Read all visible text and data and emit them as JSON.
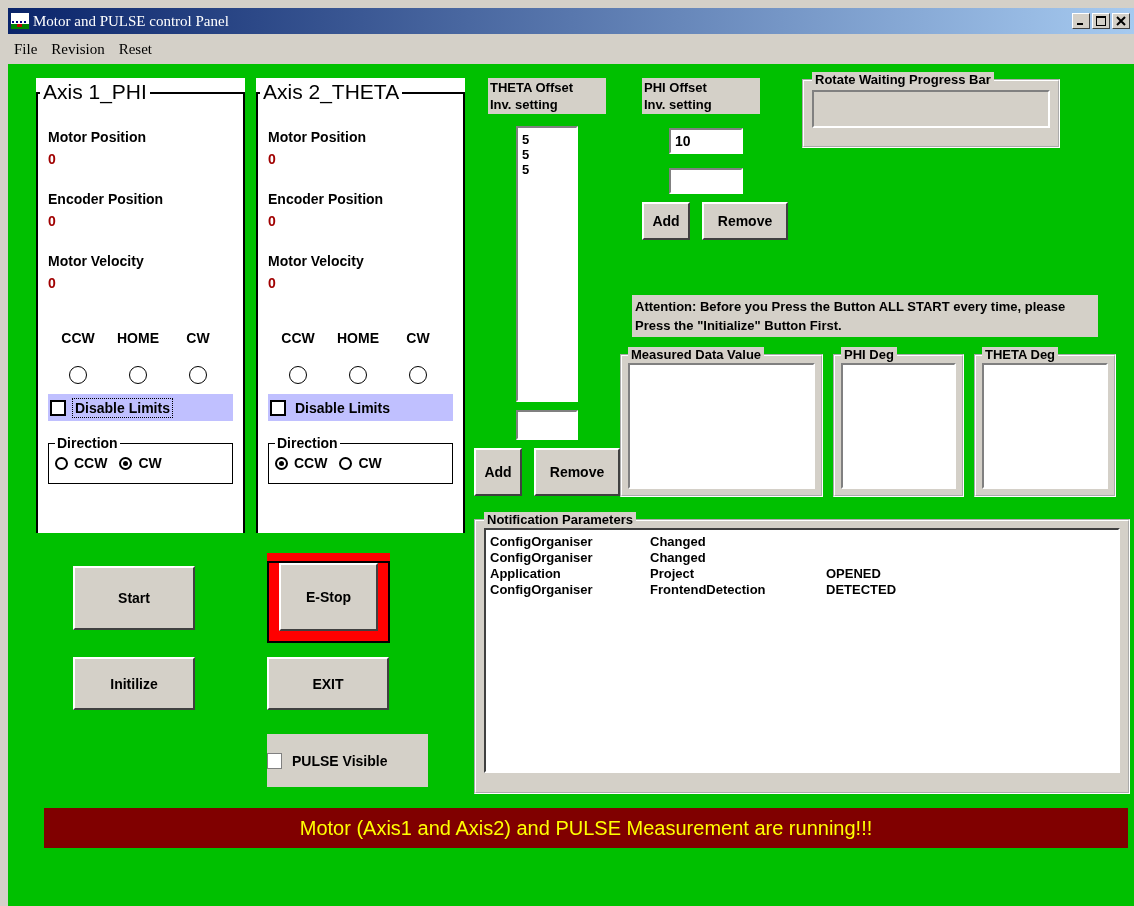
{
  "window": {
    "title": "Motor and PULSE control Panel"
  },
  "menu": [
    {
      "label": "File"
    },
    {
      "label": "Revision"
    },
    {
      "label": "Reset"
    }
  ],
  "axes": [
    {
      "title": "Axis 1_PHI",
      "readings": [
        {
          "label": "Motor Position",
          "value": "0"
        },
        {
          "label": "Encoder Position",
          "value": "0"
        },
        {
          "label": "Motor Velocity",
          "value": "0"
        }
      ],
      "limits": [
        {
          "label": "CCW",
          "lit": false
        },
        {
          "label": "HOME",
          "lit": false
        },
        {
          "label": "CW",
          "lit": false
        }
      ],
      "disable_limits": {
        "label": "Disable Limits",
        "checked": false,
        "focused": true
      },
      "direction": {
        "title": "Direction",
        "options": [
          {
            "label": "CCW",
            "selected": false
          },
          {
            "label": "CW",
            "selected": true
          }
        ]
      }
    },
    {
      "title": "Axis 2_THETA",
      "readings": [
        {
          "label": "Motor Position",
          "value": "0"
        },
        {
          "label": "Encoder Position",
          "value": "0"
        },
        {
          "label": "Motor Velocity",
          "value": "0"
        }
      ],
      "limits": [
        {
          "label": "CCW",
          "lit": false
        },
        {
          "label": "HOME",
          "lit": false
        },
        {
          "label": "CW",
          "lit": false
        }
      ],
      "disable_limits": {
        "label": "Disable Limits",
        "checked": false,
        "focused": false
      },
      "direction": {
        "title": "Direction",
        "options": [
          {
            "label": "CCW",
            "selected": true
          },
          {
            "label": "CW",
            "selected": false
          }
        ]
      }
    }
  ],
  "controls": [
    {
      "label": "Start",
      "kind": "button"
    },
    {
      "label": "E-Stop",
      "kind": "estop"
    },
    {
      "label": "Initilize",
      "kind": "button"
    },
    {
      "label": "EXIT",
      "kind": "button"
    },
    {
      "label": "PULSE Visible",
      "kind": "checkbox",
      "checked": false
    }
  ],
  "theta_offset": {
    "label": [
      "THETA Offset",
      "Inv. setting"
    ],
    "items": [
      "5",
      "5",
      "5"
    ],
    "buttons": [
      "Add",
      "Remove"
    ]
  },
  "phi_offset": {
    "label": [
      "PHI Offset",
      "Inv. setting"
    ],
    "value": "10",
    "buttons": [
      "Add",
      "Remove"
    ]
  },
  "progress": {
    "title": "Rotate Waiting Progress Bar",
    "level": 0
  },
  "attention": "Attention: Before you Press the Button ALL START every time, please Press the \"Initialize\" Button First.",
  "displays": [
    {
      "title": "Measured Data Value"
    },
    {
      "title": "PHI Deg"
    },
    {
      "title": "THETA Deg"
    }
  ],
  "notification": {
    "title": "Notification Parameters",
    "rows": [
      [
        "ConfigOrganiser",
        "Changed"
      ],
      [
        "ConfigOrganiser",
        "Changed"
      ],
      [
        "Application",
        "Project",
        "OPENED"
      ],
      [
        "ConfigOrganiser",
        "FrontendDetection",
        "DETECTED"
      ]
    ]
  },
  "status_banner": "Motor (Axis1 and Axis2) and PULSE Measurement are running!!!"
}
